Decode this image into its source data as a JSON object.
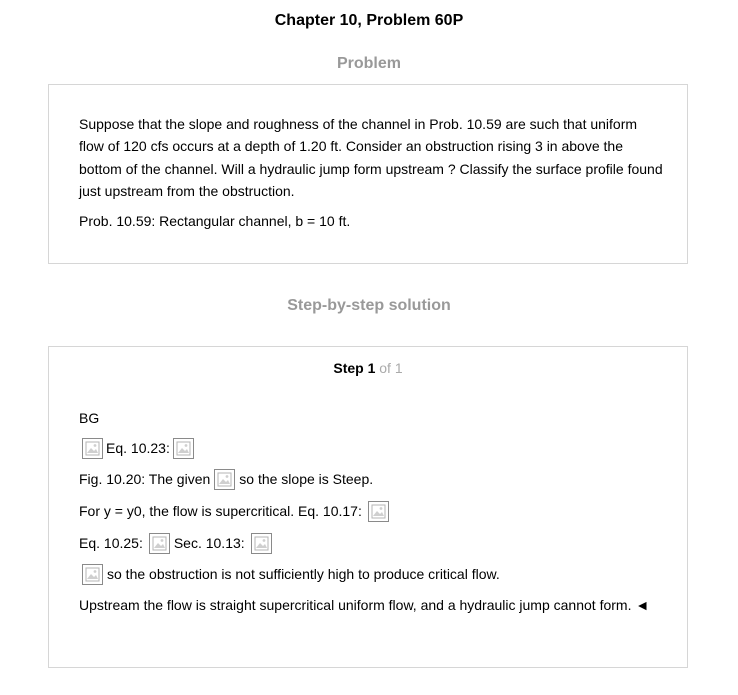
{
  "page_title": "Chapter 10, Problem 60P",
  "problem": {
    "heading": "Problem",
    "text": "Suppose that the slope and roughness of the channel in Prob. 10.59 are such that uniform flow of 120 cfs occurs at a depth of 1.20 ft. Consider an obstruction rising 3 in above the bottom of the channel. Will a hydraulic jump form upstream ? Classify the surface profile found just upstream from the obstruction.",
    "reference": "Prob. 10.59: Rectangular channel, b = 10 ft."
  },
  "solution": {
    "heading": "Step-by-step solution",
    "step_word": "Step 1",
    "step_of": "of 1",
    "lines": {
      "l1": "BG",
      "l2_a": "Eq. 10.23:",
      "l3_a": "Fig. 10.20: The given",
      "l3_b": "so the slope is Steep.",
      "l4_a": "For y = y0, the flow is supercritical. Eq. 10.17:",
      "l5_a": "Eq. 10.25:",
      "l5_b": "Sec. 10.13:",
      "l6_a": "so the obstruction is not sufficiently high to produce critical flow.",
      "l7_a": "Upstream the flow is straight supercritical uniform flow, and a hydraulic jump cannot form. ◄"
    }
  },
  "icons": {
    "image_placeholder": "broken-image-icon"
  }
}
